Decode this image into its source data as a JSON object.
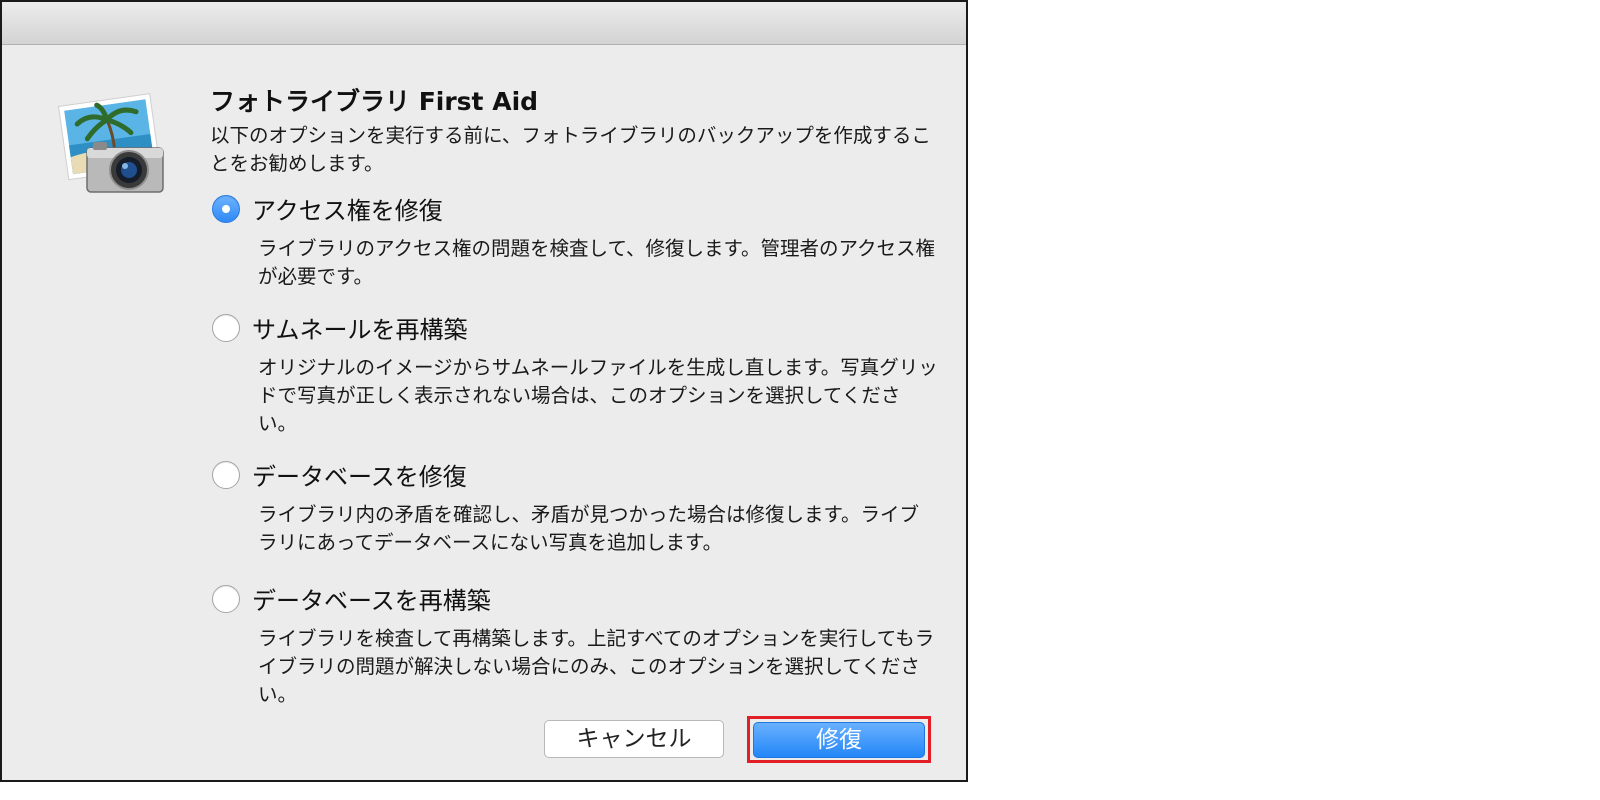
{
  "dialog": {
    "title": "フォトライブラリ First Aid",
    "intro": "以下のオプションを実行する前に、フォトライブラリのバックアップを作成することをお勧めします。",
    "app_icon": "photo-camera-icon"
  },
  "options": [
    {
      "label": "アクセス権を修復",
      "description": "ライブラリのアクセス権の問題を検査して、修復します。管理者のアクセス権が必要です。",
      "selected": true
    },
    {
      "label": "サムネールを再構築",
      "description": "オリジナルのイメージからサムネールファイルを生成し直します。写真グリッドで写真が正しく表示されない場合は、このオプションを選択してください。",
      "selected": false
    },
    {
      "label": "データベースを修復",
      "description": "ライブラリ内の矛盾を確認し、矛盾が見つかった場合は修復します。ライブラリにあってデータベースにない写真を追加します。",
      "selected": false
    },
    {
      "label": "データベースを再構築",
      "description": "ライブラリを検査して再構築します。上記すべてのオプションを実行してもライブラリの問題が解決しない場合にのみ、このオプションを選択してください。",
      "selected": false
    }
  ],
  "buttons": {
    "cancel_label": "キャンセル",
    "repair_label": "修復"
  },
  "colors": {
    "accent": "#2f89f5",
    "highlight_border": "#e21f26",
    "dialog_bg": "#ececec"
  }
}
